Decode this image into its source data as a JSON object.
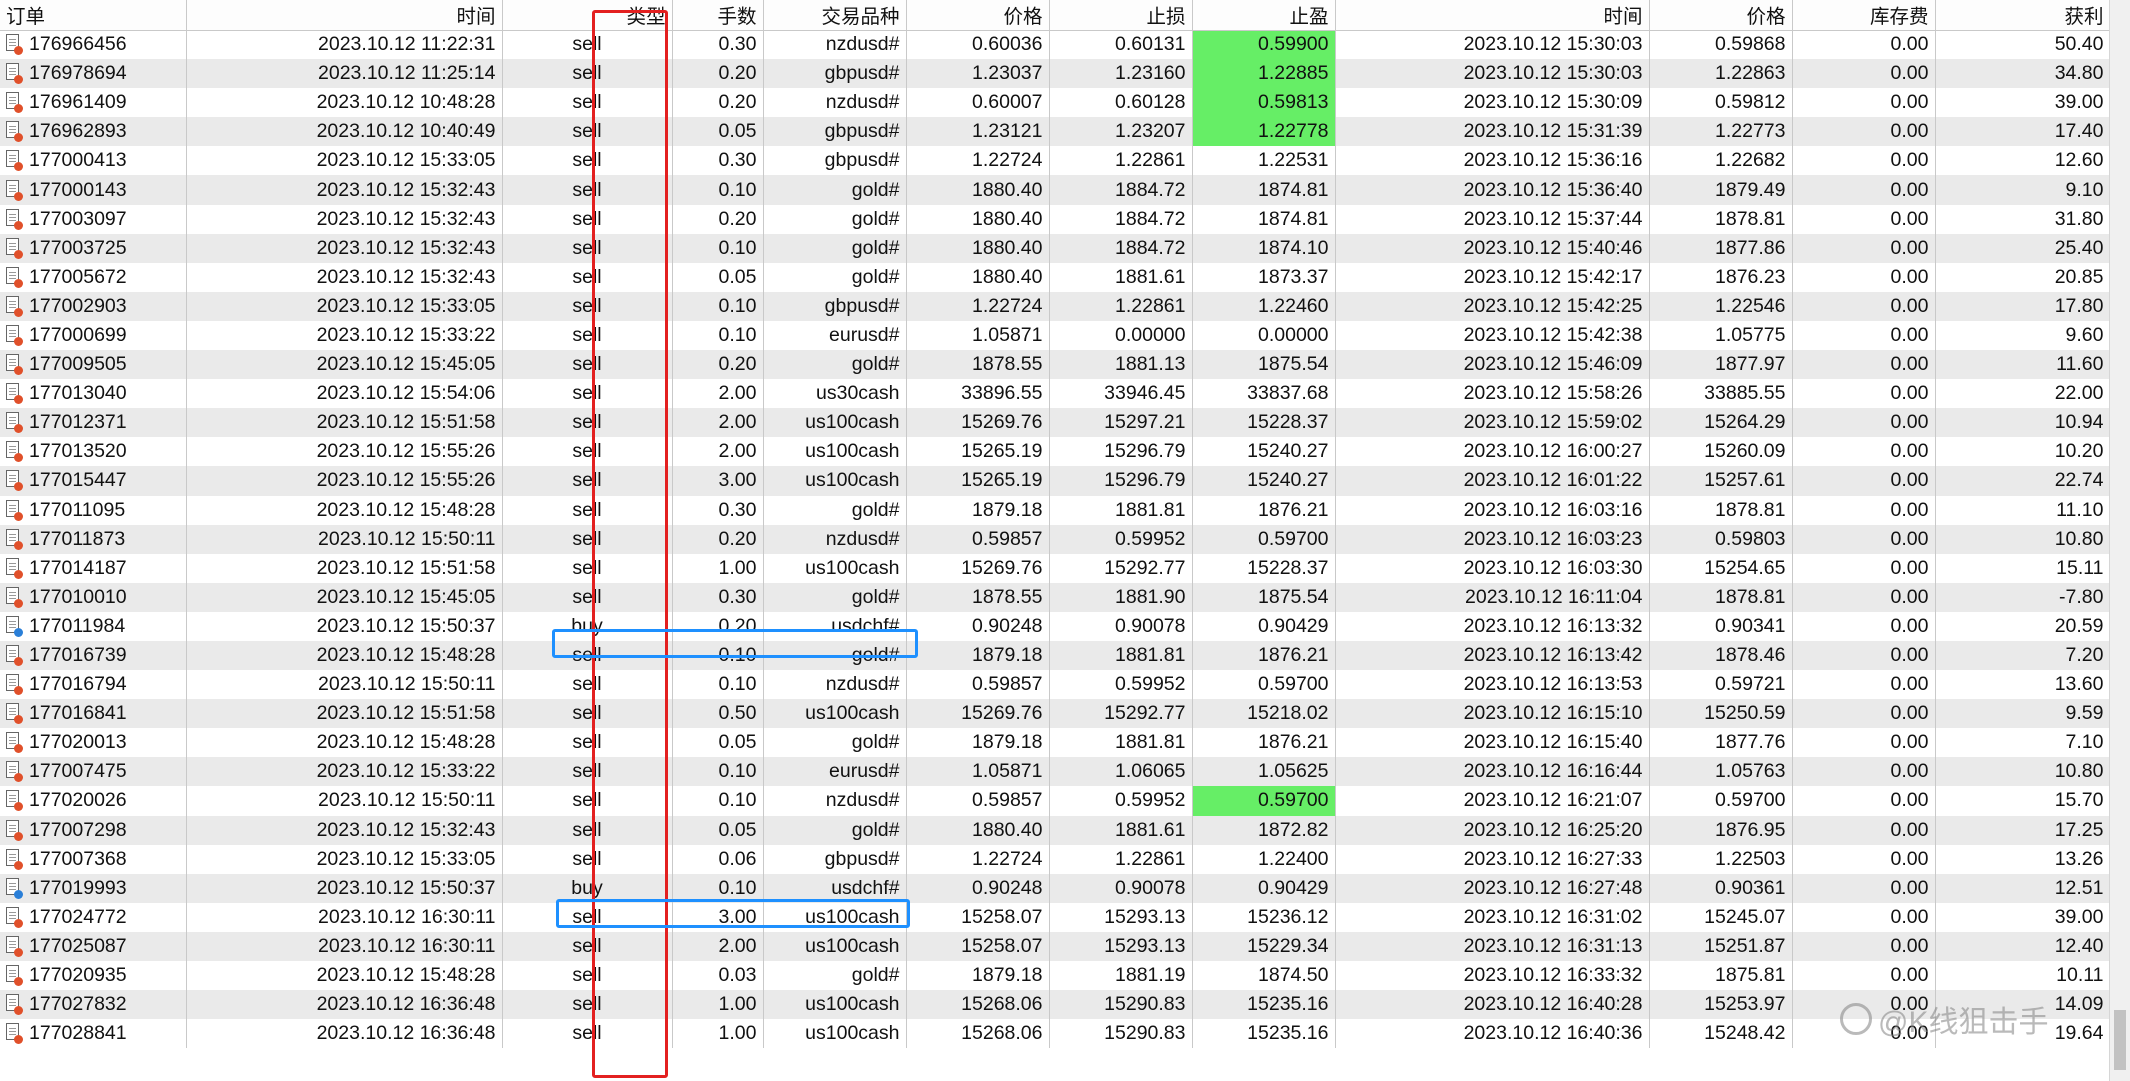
{
  "colors": {
    "tp_highlight": "#66ee66",
    "sell_dot": "#e0502a",
    "buy_dot": "#2a7fd8",
    "annotation_red": "#e32020",
    "annotation_blue": "#1e90ff",
    "row_alt": "#eaeaea"
  },
  "headers": [
    "订单",
    "时间",
    "类型",
    "手数",
    "交易品种",
    "价格",
    "止损",
    "止盈",
    "时间",
    "价格",
    "库存费",
    "获利"
  ],
  "sorted_column_index": 8,
  "rows": [
    {
      "order": "176966456",
      "open_time": "2023.10.12 11:22:31",
      "type": "sell",
      "lots": "0.30",
      "symbol": "nzdusd#",
      "open_price": "0.60036",
      "sl": "0.60131",
      "tp": "0.59900",
      "tp_hit": true,
      "close_time": "2023.10.12 15:30:03",
      "close_price": "0.59868",
      "swap": "0.00",
      "profit": "50.40"
    },
    {
      "order": "176978694",
      "open_time": "2023.10.12 11:25:14",
      "type": "sell",
      "lots": "0.20",
      "symbol": "gbpusd#",
      "open_price": "1.23037",
      "sl": "1.23160",
      "tp": "1.22885",
      "tp_hit": true,
      "close_time": "2023.10.12 15:30:03",
      "close_price": "1.22863",
      "swap": "0.00",
      "profit": "34.80"
    },
    {
      "order": "176961409",
      "open_time": "2023.10.12 10:48:28",
      "type": "sell",
      "lots": "0.20",
      "symbol": "nzdusd#",
      "open_price": "0.60007",
      "sl": "0.60128",
      "tp": "0.59813",
      "tp_hit": true,
      "close_time": "2023.10.12 15:30:09",
      "close_price": "0.59812",
      "swap": "0.00",
      "profit": "39.00"
    },
    {
      "order": "176962893",
      "open_time": "2023.10.12 10:40:49",
      "type": "sell",
      "lots": "0.05",
      "symbol": "gbpusd#",
      "open_price": "1.23121",
      "sl": "1.23207",
      "tp": "1.22778",
      "tp_hit": true,
      "close_time": "2023.10.12 15:31:39",
      "close_price": "1.22773",
      "swap": "0.00",
      "profit": "17.40"
    },
    {
      "order": "177000413",
      "open_time": "2023.10.12 15:33:05",
      "type": "sell",
      "lots": "0.30",
      "symbol": "gbpusd#",
      "open_price": "1.22724",
      "sl": "1.22861",
      "tp": "1.22531",
      "tp_hit": false,
      "close_time": "2023.10.12 15:36:16",
      "close_price": "1.22682",
      "swap": "0.00",
      "profit": "12.60"
    },
    {
      "order": "177000143",
      "open_time": "2023.10.12 15:32:43",
      "type": "sell",
      "lots": "0.10",
      "symbol": "gold#",
      "open_price": "1880.40",
      "sl": "1884.72",
      "tp": "1874.81",
      "tp_hit": false,
      "close_time": "2023.10.12 15:36:40",
      "close_price": "1879.49",
      "swap": "0.00",
      "profit": "9.10"
    },
    {
      "order": "177003097",
      "open_time": "2023.10.12 15:32:43",
      "type": "sell",
      "lots": "0.20",
      "symbol": "gold#",
      "open_price": "1880.40",
      "sl": "1884.72",
      "tp": "1874.81",
      "tp_hit": false,
      "close_time": "2023.10.12 15:37:44",
      "close_price": "1878.81",
      "swap": "0.00",
      "profit": "31.80"
    },
    {
      "order": "177003725",
      "open_time": "2023.10.12 15:32:43",
      "type": "sell",
      "lots": "0.10",
      "symbol": "gold#",
      "open_price": "1880.40",
      "sl": "1884.72",
      "tp": "1874.10",
      "tp_hit": false,
      "close_time": "2023.10.12 15:40:46",
      "close_price": "1877.86",
      "swap": "0.00",
      "profit": "25.40"
    },
    {
      "order": "177005672",
      "open_time": "2023.10.12 15:32:43",
      "type": "sell",
      "lots": "0.05",
      "symbol": "gold#",
      "open_price": "1880.40",
      "sl": "1881.61",
      "tp": "1873.37",
      "tp_hit": false,
      "close_time": "2023.10.12 15:42:17",
      "close_price": "1876.23",
      "swap": "0.00",
      "profit": "20.85"
    },
    {
      "order": "177002903",
      "open_time": "2023.10.12 15:33:05",
      "type": "sell",
      "lots": "0.10",
      "symbol": "gbpusd#",
      "open_price": "1.22724",
      "sl": "1.22861",
      "tp": "1.22460",
      "tp_hit": false,
      "close_time": "2023.10.12 15:42:25",
      "close_price": "1.22546",
      "swap": "0.00",
      "profit": "17.80"
    },
    {
      "order": "177000699",
      "open_time": "2023.10.12 15:33:22",
      "type": "sell",
      "lots": "0.10",
      "symbol": "eurusd#",
      "open_price": "1.05871",
      "sl": "0.00000",
      "tp": "0.00000",
      "tp_hit": false,
      "close_time": "2023.10.12 15:42:38",
      "close_price": "1.05775",
      "swap": "0.00",
      "profit": "9.60"
    },
    {
      "order": "177009505",
      "open_time": "2023.10.12 15:45:05",
      "type": "sell",
      "lots": "0.20",
      "symbol": "gold#",
      "open_price": "1878.55",
      "sl": "1881.13",
      "tp": "1875.54",
      "tp_hit": false,
      "close_time": "2023.10.12 15:46:09",
      "close_price": "1877.97",
      "swap": "0.00",
      "profit": "11.60"
    },
    {
      "order": "177013040",
      "open_time": "2023.10.12 15:54:06",
      "type": "sell",
      "lots": "2.00",
      "symbol": "us30cash",
      "open_price": "33896.55",
      "sl": "33946.45",
      "tp": "33837.68",
      "tp_hit": false,
      "close_time": "2023.10.12 15:58:26",
      "close_price": "33885.55",
      "swap": "0.00",
      "profit": "22.00"
    },
    {
      "order": "177012371",
      "open_time": "2023.10.12 15:51:58",
      "type": "sell",
      "lots": "2.00",
      "symbol": "us100cash",
      "open_price": "15269.76",
      "sl": "15297.21",
      "tp": "15228.37",
      "tp_hit": false,
      "close_time": "2023.10.12 15:59:02",
      "close_price": "15264.29",
      "swap": "0.00",
      "profit": "10.94"
    },
    {
      "order": "177013520",
      "open_time": "2023.10.12 15:55:26",
      "type": "sell",
      "lots": "2.00",
      "symbol": "us100cash",
      "open_price": "15265.19",
      "sl": "15296.79",
      "tp": "15240.27",
      "tp_hit": false,
      "close_time": "2023.10.12 16:00:27",
      "close_price": "15260.09",
      "swap": "0.00",
      "profit": "10.20"
    },
    {
      "order": "177015447",
      "open_time": "2023.10.12 15:55:26",
      "type": "sell",
      "lots": "3.00",
      "symbol": "us100cash",
      "open_price": "15265.19",
      "sl": "15296.79",
      "tp": "15240.27",
      "tp_hit": false,
      "close_time": "2023.10.12 16:01:22",
      "close_price": "15257.61",
      "swap": "0.00",
      "profit": "22.74"
    },
    {
      "order": "177011095",
      "open_time": "2023.10.12 15:48:28",
      "type": "sell",
      "lots": "0.30",
      "symbol": "gold#",
      "open_price": "1879.18",
      "sl": "1881.81",
      "tp": "1876.21",
      "tp_hit": false,
      "close_time": "2023.10.12 16:03:16",
      "close_price": "1878.81",
      "swap": "0.00",
      "profit": "11.10"
    },
    {
      "order": "177011873",
      "open_time": "2023.10.12 15:50:11",
      "type": "sell",
      "lots": "0.20",
      "symbol": "nzdusd#",
      "open_price": "0.59857",
      "sl": "0.59952",
      "tp": "0.59700",
      "tp_hit": false,
      "close_time": "2023.10.12 16:03:23",
      "close_price": "0.59803",
      "swap": "0.00",
      "profit": "10.80"
    },
    {
      "order": "177014187",
      "open_time": "2023.10.12 15:51:58",
      "type": "sell",
      "lots": "1.00",
      "symbol": "us100cash",
      "open_price": "15269.76",
      "sl": "15292.77",
      "tp": "15228.37",
      "tp_hit": false,
      "close_time": "2023.10.12 16:03:30",
      "close_price": "15254.65",
      "swap": "0.00",
      "profit": "15.11"
    },
    {
      "order": "177010010",
      "open_time": "2023.10.12 15:45:05",
      "type": "sell",
      "lots": "0.30",
      "symbol": "gold#",
      "open_price": "1878.55",
      "sl": "1881.90",
      "tp": "1875.54",
      "tp_hit": false,
      "close_time": "2023.10.12 16:11:04",
      "close_price": "1878.81",
      "swap": "0.00",
      "profit": "-7.80"
    },
    {
      "order": "177011984",
      "open_time": "2023.10.12 15:50:37",
      "type": "buy",
      "lots": "0.20",
      "symbol": "usdchf#",
      "open_price": "0.90248",
      "sl": "0.90078",
      "tp": "0.90429",
      "tp_hit": false,
      "close_time": "2023.10.12 16:13:32",
      "close_price": "0.90341",
      "swap": "0.00",
      "profit": "20.59"
    },
    {
      "order": "177016739",
      "open_time": "2023.10.12 15:48:28",
      "type": "sell",
      "lots": "0.10",
      "symbol": "gold#",
      "open_price": "1879.18",
      "sl": "1881.81",
      "tp": "1876.21",
      "tp_hit": false,
      "close_time": "2023.10.12 16:13:42",
      "close_price": "1878.46",
      "swap": "0.00",
      "profit": "7.20"
    },
    {
      "order": "177016794",
      "open_time": "2023.10.12 15:50:11",
      "type": "sell",
      "lots": "0.10",
      "symbol": "nzdusd#",
      "open_price": "0.59857",
      "sl": "0.59952",
      "tp": "0.59700",
      "tp_hit": false,
      "close_time": "2023.10.12 16:13:53",
      "close_price": "0.59721",
      "swap": "0.00",
      "profit": "13.60"
    },
    {
      "order": "177016841",
      "open_time": "2023.10.12 15:51:58",
      "type": "sell",
      "lots": "0.50",
      "symbol": "us100cash",
      "open_price": "15269.76",
      "sl": "15292.77",
      "tp": "15218.02",
      "tp_hit": false,
      "close_time": "2023.10.12 16:15:10",
      "close_price": "15250.59",
      "swap": "0.00",
      "profit": "9.59"
    },
    {
      "order": "177020013",
      "open_time": "2023.10.12 15:48:28",
      "type": "sell",
      "lots": "0.05",
      "symbol": "gold#",
      "open_price": "1879.18",
      "sl": "1881.81",
      "tp": "1876.21",
      "tp_hit": false,
      "close_time": "2023.10.12 16:15:40",
      "close_price": "1877.76",
      "swap": "0.00",
      "profit": "7.10"
    },
    {
      "order": "177007475",
      "open_time": "2023.10.12 15:33:22",
      "type": "sell",
      "lots": "0.10",
      "symbol": "eurusd#",
      "open_price": "1.05871",
      "sl": "1.06065",
      "tp": "1.05625",
      "tp_hit": false,
      "close_time": "2023.10.12 16:16:44",
      "close_price": "1.05763",
      "swap": "0.00",
      "profit": "10.80"
    },
    {
      "order": "177020026",
      "open_time": "2023.10.12 15:50:11",
      "type": "sell",
      "lots": "0.10",
      "symbol": "nzdusd#",
      "open_price": "0.59857",
      "sl": "0.59952",
      "tp": "0.59700",
      "tp_hit": true,
      "close_time": "2023.10.12 16:21:07",
      "close_price": "0.59700",
      "swap": "0.00",
      "profit": "15.70"
    },
    {
      "order": "177007298",
      "open_time": "2023.10.12 15:32:43",
      "type": "sell",
      "lots": "0.05",
      "symbol": "gold#",
      "open_price": "1880.40",
      "sl": "1881.61",
      "tp": "1872.82",
      "tp_hit": false,
      "close_time": "2023.10.12 16:25:20",
      "close_price": "1876.95",
      "swap": "0.00",
      "profit": "17.25"
    },
    {
      "order": "177007368",
      "open_time": "2023.10.12 15:33:05",
      "type": "sell",
      "lots": "0.06",
      "symbol": "gbpusd#",
      "open_price": "1.22724",
      "sl": "1.22861",
      "tp": "1.22400",
      "tp_hit": false,
      "close_time": "2023.10.12 16:27:33",
      "close_price": "1.22503",
      "swap": "0.00",
      "profit": "13.26"
    },
    {
      "order": "177019993",
      "open_time": "2023.10.12 15:50:37",
      "type": "buy",
      "lots": "0.10",
      "symbol": "usdchf#",
      "open_price": "0.90248",
      "sl": "0.90078",
      "tp": "0.90429",
      "tp_hit": false,
      "close_time": "2023.10.12 16:27:48",
      "close_price": "0.90361",
      "swap": "0.00",
      "profit": "12.51"
    },
    {
      "order": "177024772",
      "open_time": "2023.10.12 16:30:11",
      "type": "sell",
      "lots": "3.00",
      "symbol": "us100cash",
      "open_price": "15258.07",
      "sl": "15293.13",
      "tp": "15236.12",
      "tp_hit": false,
      "close_time": "2023.10.12 16:31:02",
      "close_price": "15245.07",
      "swap": "0.00",
      "profit": "39.00"
    },
    {
      "order": "177025087",
      "open_time": "2023.10.12 16:30:11",
      "type": "sell",
      "lots": "2.00",
      "symbol": "us100cash",
      "open_price": "15258.07",
      "sl": "15293.13",
      "tp": "15229.34",
      "tp_hit": false,
      "close_time": "2023.10.12 16:31:13",
      "close_price": "15251.87",
      "swap": "0.00",
      "profit": "12.40"
    },
    {
      "order": "177020935",
      "open_time": "2023.10.12 15:48:28",
      "type": "sell",
      "lots": "0.03",
      "symbol": "gold#",
      "open_price": "1879.18",
      "sl": "1881.19",
      "tp": "1874.50",
      "tp_hit": false,
      "close_time": "2023.10.12 16:33:32",
      "close_price": "1875.81",
      "swap": "0.00",
      "profit": "10.11"
    },
    {
      "order": "177027832",
      "open_time": "2023.10.12 16:36:48",
      "type": "sell",
      "lots": "1.00",
      "symbol": "us100cash",
      "open_price": "15268.06",
      "sl": "15290.83",
      "tp": "15235.16",
      "tp_hit": false,
      "close_time": "2023.10.12 16:40:28",
      "close_price": "15253.97",
      "swap": "0.00",
      "profit": "14.09"
    },
    {
      "order": "177028841",
      "open_time": "2023.10.12 16:36:48",
      "type": "sell",
      "lots": "1.00",
      "symbol": "us100cash",
      "open_price": "15268.06",
      "sl": "15290.83",
      "tp": "15235.16",
      "tp_hit": false,
      "close_time": "2023.10.12 16:40:36",
      "close_price": "15248.42",
      "swap": "0.00",
      "profit": "19.64"
    }
  ],
  "watermark": "@K线狙击手"
}
